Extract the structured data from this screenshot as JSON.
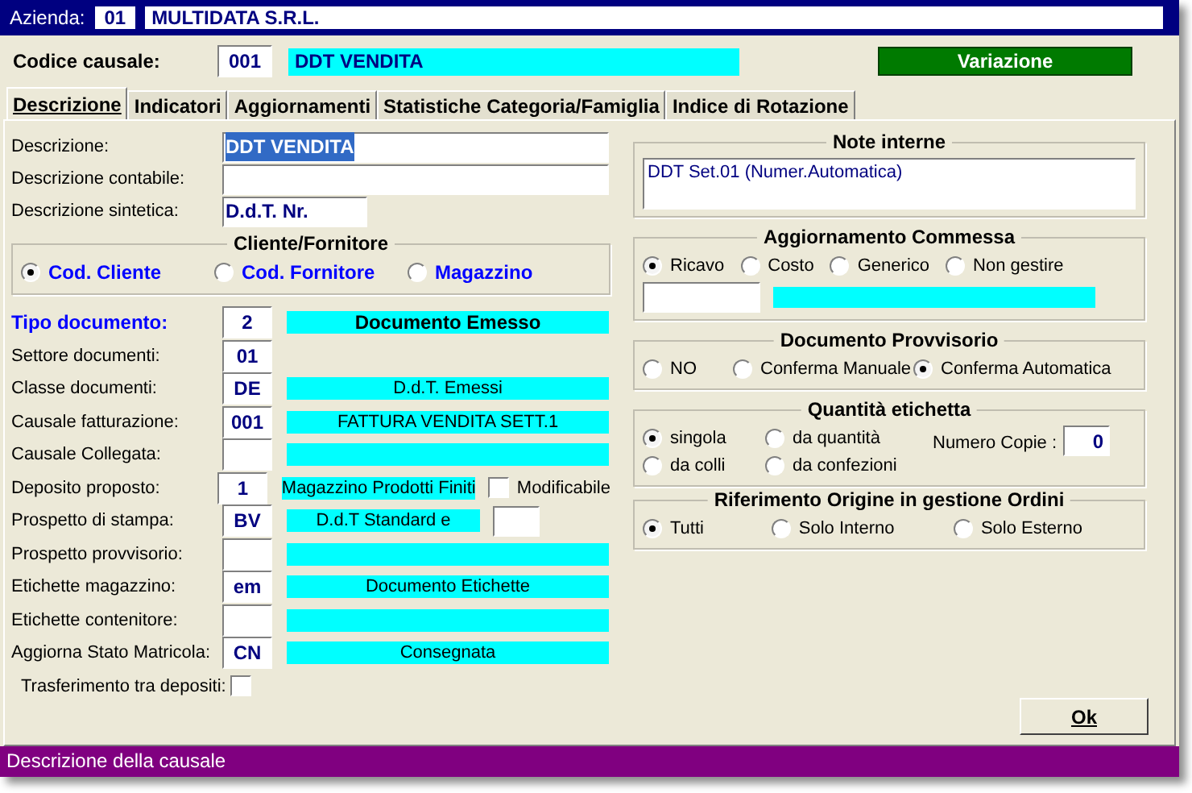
{
  "header": {
    "company_label": "Azienda:",
    "company_code": "01",
    "company_name": "MULTIDATA S.R.L."
  },
  "causale": {
    "label": "Codice causale:",
    "code": "001",
    "name": "DDT VENDITA",
    "mode_button": "Variazione"
  },
  "tabs": [
    {
      "label": "Descrizione",
      "selected": true
    },
    {
      "label": "Indicatori",
      "selected": false
    },
    {
      "label": "Aggiornamenti",
      "selected": false
    },
    {
      "label": "Statistiche Categoria/Famiglia",
      "selected": false
    },
    {
      "label": "Indice di Rotazione",
      "selected": false
    }
  ],
  "description_fields": [
    {
      "label": "Descrizione:",
      "value": "DDT VENDITA",
      "kind": "long",
      "selected_text": true
    },
    {
      "label": "Descrizione contabile:",
      "kind": "long"
    },
    {
      "label": "Descrizione sintetica:",
      "value": "D.d.T. Nr.",
      "kind": "short"
    }
  ],
  "cliente_fornitore": {
    "title": "Cliente/Fornitore",
    "options": [
      {
        "label": "Cod. Cliente",
        "selected": true
      },
      {
        "label": "Cod. Fornitore",
        "selected": false
      },
      {
        "label": "Magazzino",
        "selected": false
      }
    ]
  },
  "document_fields": [
    {
      "label": "Tipo documento:",
      "code": "2",
      "description": "Documento Emesso",
      "kind": "code_desc",
      "emphasis": true
    },
    {
      "label": "Settore documenti:",
      "code": "01",
      "kind": "code_only",
      "emphasis": false
    },
    {
      "label": "Classe documenti:",
      "code": "DE",
      "description": "D.d.T. Emessi",
      "kind": "code_desc",
      "emphasis": false
    },
    {
      "label": "Causale fatturazione:",
      "code": "001",
      "description": "FATTURA VENDITA SETT.1",
      "kind": "code_desc",
      "emphasis": false
    },
    {
      "label": "Causale Collegata:",
      "kind": "code_desc",
      "emphasis": false
    },
    {
      "label": "Deposito proposto:",
      "code": "1",
      "description": "Magazzino Prodotti Finiti",
      "kind": "code_desc_check",
      "check_label": "Modificabile",
      "checked": false,
      "emphasis": false
    },
    {
      "label": "Prospetto di stampa:",
      "code": "BV",
      "description": "D.d.T Standard e",
      "kind": "code_desc_box",
      "emphasis": false
    },
    {
      "label": "Prospetto provvisorio:",
      "kind": "code_desc",
      "emphasis": false
    },
    {
      "label": "Etichette magazzino:",
      "code": "em",
      "description": "Documento Etichette",
      "kind": "code_desc",
      "emphasis": false
    },
    {
      "label": "Etichette contenitore:",
      "kind": "code_desc",
      "emphasis": false
    },
    {
      "label": "Aggiorna Stato Matricola:",
      "code": "CN",
      "description": "Consegnata",
      "kind": "code_desc",
      "emphasis": false
    },
    {
      "label": "Trasferimento tra depositi:",
      "kind": "checkbox",
      "checked": false,
      "emphasis": false
    }
  ],
  "note_interne": {
    "title": "Note interne",
    "text": "DDT Set.01 (Numer.Automatica)"
  },
  "aggiornamento_commessa": {
    "title": "Aggiornamento Commessa",
    "options": [
      {
        "label": "Ricavo",
        "selected": true
      },
      {
        "label": "Costo",
        "selected": false
      },
      {
        "label": "Generico",
        "selected": false
      },
      {
        "label": "Non gestire",
        "selected": false
      }
    ]
  },
  "documento_provvisorio": {
    "title": "Documento Provvisorio",
    "options": [
      {
        "label": "NO",
        "selected": false
      },
      {
        "label": "Conferma Manuale",
        "selected": false
      },
      {
        "label": "Conferma Automatica",
        "selected": true
      }
    ]
  },
  "quantita_etichetta": {
    "title": "Quantità etichetta",
    "options": [
      {
        "label": "singola",
        "selected": true
      },
      {
        "label": "da quantità",
        "selected": false
      },
      {
        "label": "da colli",
        "selected": false
      },
      {
        "label": "da confezioni",
        "selected": false
      }
    ],
    "copies_label": "Numero Copie :",
    "copies": "0"
  },
  "riferimento_origine": {
    "title": "Riferimento Origine in gestione Ordini",
    "options": [
      {
        "label": "Tutti",
        "selected": true
      },
      {
        "label": "Solo Interno",
        "selected": false
      },
      {
        "label": "Solo Esterno",
        "selected": false
      }
    ]
  },
  "ok_button": "Ok",
  "status_bar": "Descrizione della causale"
}
